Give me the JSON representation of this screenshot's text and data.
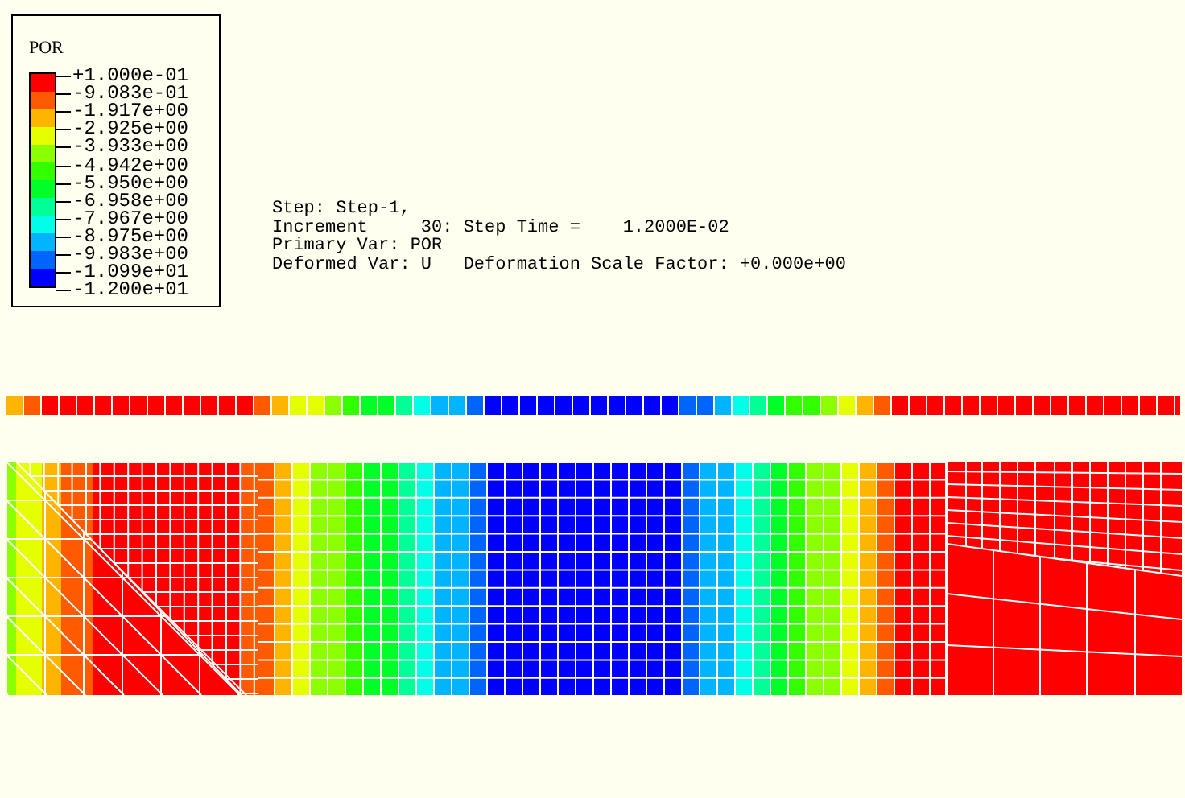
{
  "legend": {
    "title": "POR",
    "labels": [
      "+1.000e-01",
      "-9.083e-01",
      "-1.917e+00",
      "-2.925e+00",
      "-3.933e+00",
      "-4.942e+00",
      "-5.950e+00",
      "-6.958e+00",
      "-7.967e+00",
      "-8.975e+00",
      "-9.983e+00",
      "-1.099e+01",
      "-1.200e+01"
    ],
    "bands": [
      {
        "color": "#ff0000"
      },
      {
        "color": "#ff5a00"
      },
      {
        "color": "#ffb400"
      },
      {
        "color": "#e6ff00"
      },
      {
        "color": "#8cff00"
      },
      {
        "color": "#32ff00"
      },
      {
        "color": "#00ff28"
      },
      {
        "color": "#00ff96"
      },
      {
        "color": "#00ffe6"
      },
      {
        "color": "#00b4ff"
      },
      {
        "color": "#0064ff"
      },
      {
        "color": "#0000ff"
      }
    ]
  },
  "info": [
    "Step: Step-1,",
    "Increment     30: Step Time =    1.2000E-02",
    "Primary Var: POR",
    "Deformed Var: U   Deformation Scale Factor: +0.000e+00"
  ]
}
